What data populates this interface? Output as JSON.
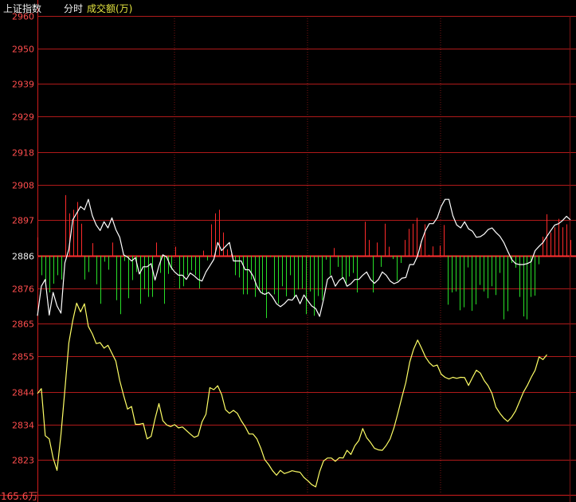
{
  "header": {
    "index_name": "上证指数",
    "mode": "分时",
    "metric": "成交额(万)"
  },
  "colors": {
    "background": "#000000",
    "grid": "#b01a1a",
    "grid_vertical": "#7a1414",
    "axis_frame": "#d01c1c",
    "tick_text": "#ff4d4d",
    "baseline": "#ff3030",
    "index_line": "#ffffff",
    "average_line": "#ffff66",
    "bar_up": "#ff2a2a",
    "bar_down": "#28e028",
    "header_text": "#f0f0f0",
    "metric_text": "#e6e640",
    "volume_label": "#ff4d4d"
  },
  "chart_data": {
    "type": "line",
    "title": "",
    "xlabel": "",
    "ylabel": "",
    "ylim": [
      2813.5,
      2960
    ],
    "baseline": 2886,
    "y_ticks": [
      "2960",
      "2950",
      "2939",
      "2929",
      "2918",
      "2908",
      "2897",
      "2886",
      "2876",
      "2865",
      "2855",
      "2844",
      "2834",
      "2823"
    ],
    "volume_label": "165.6万",
    "grid": true,
    "series": [
      {
        "key": "index",
        "values": [
          2867.5,
          2876.6,
          2878.7,
          2867.7,
          2874.7,
          2870.5,
          2868.3,
          2883.8,
          2888.0,
          2897.1,
          2899.1,
          2901.2,
          2900.2,
          2903.4,
          2898.4,
          2895.5,
          2893.8,
          2896.5,
          2894.6,
          2897.7,
          2894.1,
          2891.7,
          2886.3,
          2885.6,
          2884.4,
          2885.4,
          2880.4,
          2882.6,
          2882.6,
          2883.6,
          2878.5,
          2882.9,
          2886.3,
          2885.6,
          2882.6,
          2881.0,
          2880.0,
          2880.0,
          2878.7,
          2880.7,
          2879.8,
          2878.7,
          2878.2,
          2881.0,
          2882.9,
          2884.9,
          2890.1,
          2887.6,
          2888.9,
          2890.1,
          2884.4,
          2884.4,
          2884.4,
          2881.7,
          2881.7,
          2879.8,
          2876.6,
          2874.7,
          2874.1,
          2874.7,
          2873.3,
          2871.2,
          2870.3,
          2871.2,
          2872.5,
          2872.3,
          2873.9,
          2871.2,
          2873.9,
          2872.1,
          2870.5,
          2869.7,
          2867.3,
          2872.5,
          2878.7,
          2879.8,
          2876.6,
          2878.4,
          2879.3,
          2876.6,
          2877.4,
          2878.7,
          2878.7,
          2880.0,
          2881.0,
          2878.7,
          2877.5,
          2878.7,
          2881.0,
          2880.0,
          2878.2,
          2877.4,
          2877.9,
          2879.1,
          2879.3,
          2883.3,
          2883.3,
          2886.0,
          2890.5,
          2893.8,
          2895.9,
          2895.9,
          2897.7,
          2901.2,
          2903.4,
          2903.4,
          2898.4,
          2895.5,
          2894.6,
          2896.5,
          2894.3,
          2893.6,
          2891.7,
          2891.9,
          2892.7,
          2894.1,
          2894.6,
          2893.2,
          2892.0,
          2890.1,
          2887.4,
          2884.9,
          2883.6,
          2883.3,
          2883.3,
          2883.6,
          2884.2,
          2887.6,
          2888.9,
          2890.1,
          2892.0,
          2893.8,
          2895.5,
          2895.9,
          2896.9,
          2898.2,
          2897.1
        ]
      },
      {
        "key": "average",
        "values": [
          2843.5,
          2845.0,
          2830.5,
          2829.5,
          2823.6,
          2819.8,
          2830.8,
          2844.5,
          2859.1,
          2866.0,
          2871.4,
          2868.7,
          2871.2,
          2864.2,
          2861.9,
          2858.9,
          2859.2,
          2857.5,
          2858.4,
          2855.9,
          2853.5,
          2847.5,
          2842.9,
          2838.7,
          2839.5,
          2834.0,
          2834.0,
          2834.3,
          2829.5,
          2830.3,
          2835.7,
          2840.4,
          2835.1,
          2833.8,
          2833.3,
          2833.9,
          2832.9,
          2833.2,
          2832.1,
          2831.0,
          2830.0,
          2830.5,
          2834.8,
          2837.1,
          2845.3,
          2844.7,
          2845.9,
          2843.2,
          2838.5,
          2837.4,
          2838.3,
          2837.4,
          2835.1,
          2833.3,
          2831.0,
          2831.0,
          2829.5,
          2826.6,
          2823.1,
          2821.6,
          2819.7,
          2818.3,
          2819.8,
          2818.8,
          2819.2,
          2819.7,
          2819.4,
          2819.2,
          2817.6,
          2816.6,
          2815.4,
          2814.7,
          2819.4,
          2822.7,
          2823.6,
          2823.6,
          2822.6,
          2823.7,
          2823.6,
          2826.0,
          2824.7,
          2827.4,
          2829.0,
          2832.7,
          2829.9,
          2828.4,
          2826.6,
          2826.1,
          2826.0,
          2827.5,
          2829.5,
          2833.0,
          2837.6,
          2842.4,
          2846.9,
          2853.2,
          2857.2,
          2860.0,
          2857.5,
          2854.8,
          2853.0,
          2851.9,
          2852.3,
          2849.5,
          2848.5,
          2848.0,
          2848.5,
          2848.2,
          2848.5,
          2848.4,
          2846.0,
          2848.4,
          2850.7,
          2849.8,
          2847.5,
          2845.9,
          2843.5,
          2839.3,
          2837.4,
          2835.9,
          2834.9,
          2836.2,
          2838.1,
          2841.0,
          2843.9,
          2846.0,
          2848.5,
          2850.7,
          2854.8,
          2854.0,
          2855.5
        ]
      },
      {
        "key": "volume_bars",
        "values": [
          2891.7,
          2880.0,
          2878.0,
          2874.7,
          2877.4,
          2880.0,
          2878.7,
          2904.7,
          2899.1,
          2900.2,
          2902.6,
          2895.9,
          2878.7,
          2881.0,
          2889.9,
          2877.2,
          2871.2,
          2884.2,
          2881.7,
          2890.1,
          2872.3,
          2868.0,
          2884.4,
          2872.9,
          2878.5,
          2881.0,
          2871.2,
          2875.7,
          2873.3,
          2873.3,
          2890.1,
          2880.7,
          2871.2,
          2880.4,
          2881.7,
          2888.8,
          2875.9,
          2876.6,
          2880.0,
          2881.5,
          2880.0,
          2875.9,
          2887.6,
          2884.6,
          2895.7,
          2899.1,
          2900.2,
          2893.2,
          2888.0,
          2886.6,
          2880.0,
          2879.3,
          2874.1,
          2874.1,
          2878.7,
          2873.3,
          2875.2,
          2874.1,
          2866.8,
          2885.6,
          2874.1,
          2871.2,
          2876.6,
          2873.5,
          2880.0,
          2872.9,
          2875.6,
          2875.8,
          2868.0,
          2875.0,
          2867.5,
          2873.6,
          2872.3,
          2884.8,
          2880.0,
          2888.4,
          2882.6,
          2879.0,
          2876.8,
          2879.6,
          2880.7,
          2874.7,
          2886.0,
          2896.5,
          2890.9,
          2874.7,
          2890.1,
          2882.6,
          2895.9,
          2888.8,
          2885.0,
          2878.2,
          2883.8,
          2890.9,
          2894.3,
          2895.9,
          2897.7,
          2890.5,
          2895.7,
          2886.3,
          2888.9,
          2886.1,
          2889.1,
          2895.5,
          2870.9,
          2874.7,
          2875.0,
          2869.2,
          2870.1,
          2882.4,
          2869.0,
          2871.0,
          2877.0,
          2875.0,
          2872.9,
          2876.6,
          2873.9,
          2880.7,
          2866.4,
          2868.9,
          2883.8,
          2882.3,
          2873.3,
          2867.3,
          2866.4,
          2873.3,
          2873.7,
          2883.4,
          2891.9,
          2898.8,
          2893.2,
          2894.8,
          2897.4,
          2894.8,
          2895.7,
          2890.9
        ]
      }
    ]
  }
}
